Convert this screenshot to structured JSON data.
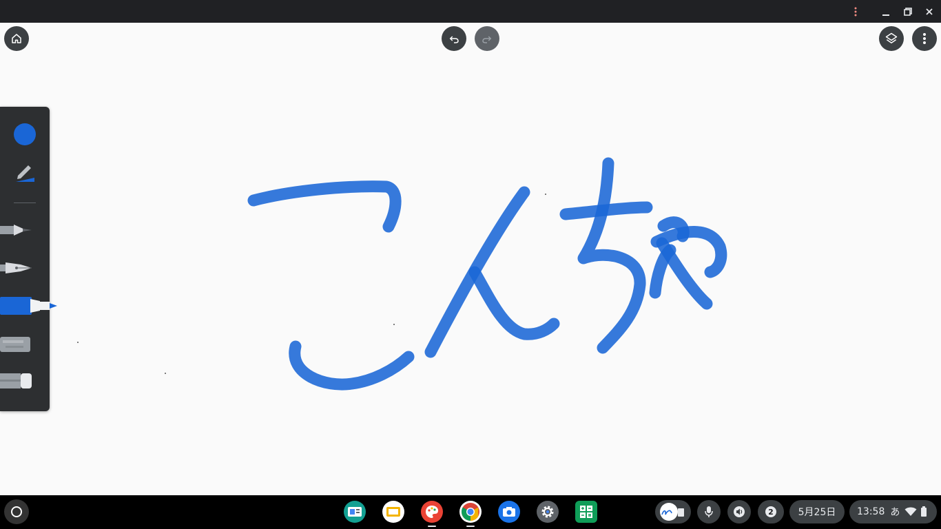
{
  "window": {
    "controls": [
      "more-vert-icon",
      "minimize-icon",
      "restore-icon",
      "close-icon"
    ],
    "colors": {
      "titlebar": "#202124"
    }
  },
  "canvas": {
    "background": "#fafafa",
    "stroke_color": "#1a66d6",
    "handwriting": "こんちゃ"
  },
  "toolbar": {
    "home_icon": "home-icon",
    "undo_icon": "undo-icon",
    "redo_icon": "redo-icon",
    "layers_icon": "layers-icon",
    "menu_icon": "more-vert-icon"
  },
  "palette": {
    "color": "#1a66d6",
    "tools": [
      "pencil-tool",
      "fountain-pen-tool",
      "marker-tool",
      "chalk-tool",
      "eraser-tool"
    ],
    "selected_tool": "marker-tool"
  },
  "shelf": {
    "apps": [
      "news-app",
      "slides-app",
      "paint-app",
      "chrome-browser",
      "camera-app",
      "settings-app",
      "calculator-app"
    ],
    "tray": {
      "notification_count": "2",
      "date": "5月25日",
      "time": "13:58",
      "ime": "あ"
    }
  }
}
